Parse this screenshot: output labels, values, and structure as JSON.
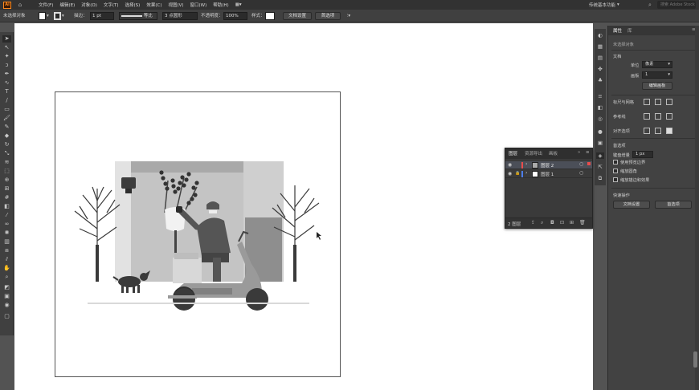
{
  "menubar": {
    "logo": "Ai",
    "items": [
      "文件(F)",
      "编辑(E)",
      "对象(O)",
      "文字(T)",
      "选择(S)",
      "效果(C)",
      "视图(V)",
      "窗口(W)",
      "帮助(H)"
    ],
    "workspace": "传统基本功能",
    "search_placeholder": "搜索 Adobe Stock"
  },
  "controlbar": {
    "selection_status": "未选择对象",
    "stroke_label": "描边：",
    "stroke_value": "1 pt",
    "stroke_style": "等比",
    "brush_value": "3 点圆形",
    "opacity_label": "不透明度：",
    "opacity_value": "100%",
    "style_label": "样式：",
    "doc_setup_btn": "文档设置",
    "prefs_btn": "首选项"
  },
  "layers_panel": {
    "tabs": [
      "图层",
      "资源导出",
      "画板"
    ],
    "layers": [
      {
        "name": "图层 2",
        "selected": true,
        "color": "#e84d4d"
      },
      {
        "name": "图层 1",
        "selected": false,
        "color": "#4d7de8"
      }
    ],
    "footer_count": "2 图层"
  },
  "properties": {
    "tabs": [
      "属性",
      "库"
    ],
    "status": "未选择对象",
    "document_section": "文档",
    "unit_label": "单位",
    "unit_value": "像素",
    "artboard_label": "画板",
    "artboard_value": "1",
    "edit_artboard_btn": "编辑画板",
    "rulers_grid_label": "标尺与网格",
    "guides_label": "参考线",
    "align_label": "对齐选项",
    "preferences_section": "首选项",
    "keyboard_inc_label": "键盘增量",
    "keyboard_inc_value": "1 px",
    "opt_preview_bounds": "使用预览边界",
    "opt_scale_corners": "缩放圆角",
    "opt_scale_strokes": "缩放描边和效果",
    "quick_actions": "快速操作",
    "doc_setup_btn": "文档设置",
    "prefs_btn": "首选项"
  },
  "colors": {
    "selection_highlight": "#4b4f58",
    "app_logo": "#ff8a1e"
  }
}
